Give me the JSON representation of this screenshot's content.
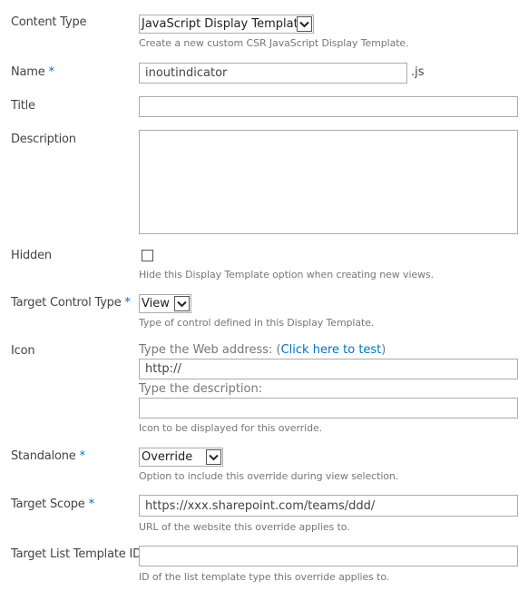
{
  "fields": {
    "content_type": {
      "label": "Content Type",
      "selected": "JavaScript Display Template",
      "description": "Create a new custom CSR JavaScript Display Template."
    },
    "name": {
      "label": "Name",
      "required_mark": "*",
      "value": "inoutindicator",
      "suffix": ".js"
    },
    "title": {
      "label": "Title",
      "value": ""
    },
    "description": {
      "label": "Description",
      "value": ""
    },
    "hidden": {
      "label": "Hidden",
      "checked": false,
      "description": "Hide this Display Template option when creating new views."
    },
    "target_control_type": {
      "label": "Target Control Type",
      "required_mark": "*",
      "selected": "View",
      "description": "Type of control defined in this Display Template."
    },
    "icon": {
      "label": "Icon",
      "web_address_prefix": "Type the Web address: (",
      "test_link": "Click here to test",
      "web_address_suffix": ")",
      "url_value": "http://",
      "description_label": "Type the description:",
      "description_value": "",
      "description": "Icon to be displayed for this override."
    },
    "standalone": {
      "label": "Standalone",
      "required_mark": "*",
      "selected": "Override",
      "description": "Option to include this override during view selection."
    },
    "target_scope": {
      "label": "Target Scope",
      "required_mark": "*",
      "value": "https://xxx.sharepoint.com/teams/ddd/",
      "description": "URL of the website this override applies to."
    },
    "target_list_template_id": {
      "label": "Target List Template ID",
      "value": "",
      "description": "ID of the list template type this override applies to."
    }
  },
  "colors": {
    "accent": "#0072c6",
    "label_text": "#444444",
    "hint_text": "#777777",
    "border": "#ababab"
  }
}
